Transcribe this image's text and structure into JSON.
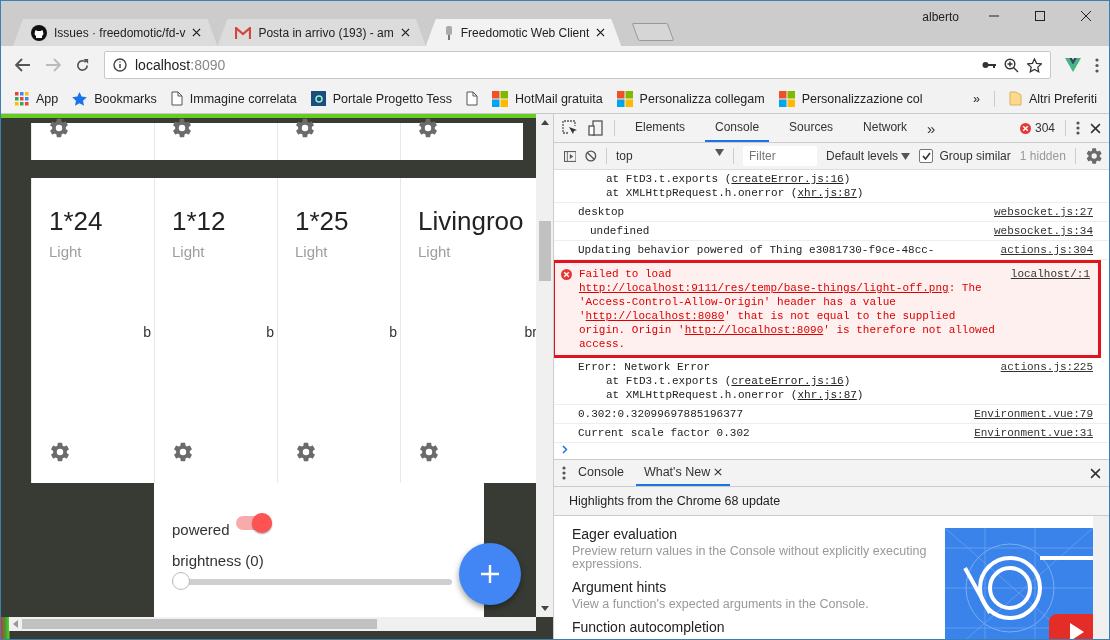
{
  "browser": {
    "tabs": [
      {
        "title": "Issues · freedomotic/fd-v",
        "selected": false
      },
      {
        "title": "Posta in arrivo (193) - am",
        "selected": false
      },
      {
        "title": "Freedomotic Web Client",
        "selected": true
      }
    ],
    "user": "alberto",
    "address": {
      "host": "localhost",
      "port": ":8090"
    },
    "bookmarks": [
      {
        "label": "App",
        "kind": "apps"
      },
      {
        "label": "Bookmarks",
        "kind": "star"
      },
      {
        "label": "Immagine correlata",
        "kind": "page"
      },
      {
        "label": "Portale Progetto Tess",
        "kind": "site"
      },
      {
        "kind": "page"
      },
      {
        "label": "HotMail gratuita",
        "kind": "windows"
      },
      {
        "label": "Personalizza collegam",
        "kind": "windows"
      },
      {
        "label": "Personalizzazione col",
        "kind": "windows"
      }
    ],
    "overflow": "»",
    "other_bookmarks": "Altri Preferiti"
  },
  "page": {
    "cards": [
      {
        "title": "1*24",
        "type": "Light",
        "edge_text": "b"
      },
      {
        "title": "1*12",
        "type": "Light",
        "edge_text": "b"
      },
      {
        "title": "1*25",
        "type": "Light",
        "edge_text": "b"
      },
      {
        "title": "Livingroo",
        "type": "Light",
        "edge_text": "br"
      }
    ],
    "panel": {
      "toggle": {
        "label": "powered",
        "on": true
      },
      "slider": {
        "label": "brightness (0)",
        "level": 0
      }
    }
  },
  "devtools": {
    "tabs": [
      {
        "label": "Elements",
        "selected": false
      },
      {
        "label": "Console",
        "selected": true
      },
      {
        "label": "Sources",
        "selected": false
      },
      {
        "label": "Network",
        "selected": false
      }
    ],
    "more": "»",
    "error_count": "304",
    "toolbar": {
      "context": "top",
      "filter_placeholder": "Filter",
      "levels": "Default levels",
      "group_similar": {
        "label": "Group similar",
        "checked": true
      },
      "hidden": "1 hidden"
    },
    "console": [
      {
        "kind": "log",
        "lines": [
          {
            "kind": "stack",
            "parts": [
              {
                "kind": "text",
                "text": "at FtD3.t.exports ("
              },
              {
                "kind": "link",
                "text": "createError.js:16"
              },
              {
                "kind": "text",
                "text": ")"
              }
            ]
          },
          {
            "kind": "stack",
            "parts": [
              {
                "kind": "text",
                "text": "at XMLHttpRequest.h.onerror ("
              },
              {
                "kind": "link",
                "text": "xhr.js:87"
              },
              {
                "kind": "text",
                "text": ")"
              }
            ]
          }
        ]
      },
      {
        "kind": "log",
        "lines": [
          {
            "kind": "message",
            "parts": [
              {
                "kind": "text",
                "text": "desktop"
              }
            ]
          }
        ],
        "source": "websocket.js:27"
      },
      {
        "kind": "child",
        "lines": [
          {
            "kind": "message",
            "parts": [
              {
                "kind": "text",
                "text": "undefined"
              }
            ]
          }
        ],
        "source": "websocket.js:34"
      },
      {
        "kind": "log",
        "lines": [
          {
            "kind": "message",
            "parts": [
              {
                "kind": "text",
                "text": "Updating behavior powered of Thing e3081730-f9ce-48cc-"
              }
            ]
          }
        ],
        "source": "actions.js:304"
      },
      {
        "kind": "error",
        "lines": [
          {
            "kind": "message",
            "parts": [
              {
                "kind": "text",
                "text": "Failed to load "
              },
              {
                "kind": "link",
                "text": "http://localhost:9111/res/temp/base-things/light-off.png"
              },
              {
                "kind": "text",
                "text": ": The 'Access-Control-Allow-Origin' header has a value '"
              },
              {
                "kind": "link",
                "text": "http://localhost:8080"
              },
              {
                "kind": "text",
                "text": "' that is not equal to the supplied origin. Origin '"
              },
              {
                "kind": "link",
                "text": "http://localhost:8090"
              },
              {
                "kind": "text",
                "text": "' is therefore not allowed access."
              }
            ]
          }
        ],
        "source": "localhost/:1"
      },
      {
        "kind": "log",
        "lines": [
          {
            "kind": "message",
            "parts": [
              {
                "kind": "text",
                "text": "Error: Network Error"
              }
            ]
          },
          {
            "kind": "stack",
            "parts": [
              {
                "kind": "text",
                "text": "at FtD3.t.exports ("
              },
              {
                "kind": "link",
                "text": "createError.js:16"
              },
              {
                "kind": "text",
                "text": ")"
              }
            ]
          },
          {
            "kind": "stack",
            "parts": [
              {
                "kind": "text",
                "text": "at XMLHttpRequest.h.onerror ("
              },
              {
                "kind": "link",
                "text": "xhr.js:87"
              },
              {
                "kind": "text",
                "text": ")"
              }
            ]
          }
        ],
        "source": "actions.js:225"
      },
      {
        "kind": "log",
        "lines": [
          {
            "kind": "message",
            "parts": [
              {
                "kind": "text",
                "text": "0.302:0.32099697885196377"
              }
            ]
          }
        ],
        "source": "Environment.vue:79"
      },
      {
        "kind": "log",
        "lines": [
          {
            "kind": "message",
            "parts": [
              {
                "kind": "text",
                "text": "Current scale factor 0.302"
              }
            ]
          }
        ],
        "source": "Environment.vue:31"
      }
    ],
    "drawer": {
      "tabs": [
        {
          "label": "Console",
          "selected": false
        },
        {
          "label": "What's New",
          "selected": true
        }
      ],
      "heading": "Highlights from the Chrome 68 update",
      "features": [
        {
          "title": "Eager evaluation",
          "text": "Preview return values in the Console without explicitly executing expressions."
        },
        {
          "title": "Argument hints",
          "text": "View a function's expected arguments in the Console."
        },
        {
          "title": "Function autocompletion"
        }
      ]
    }
  }
}
